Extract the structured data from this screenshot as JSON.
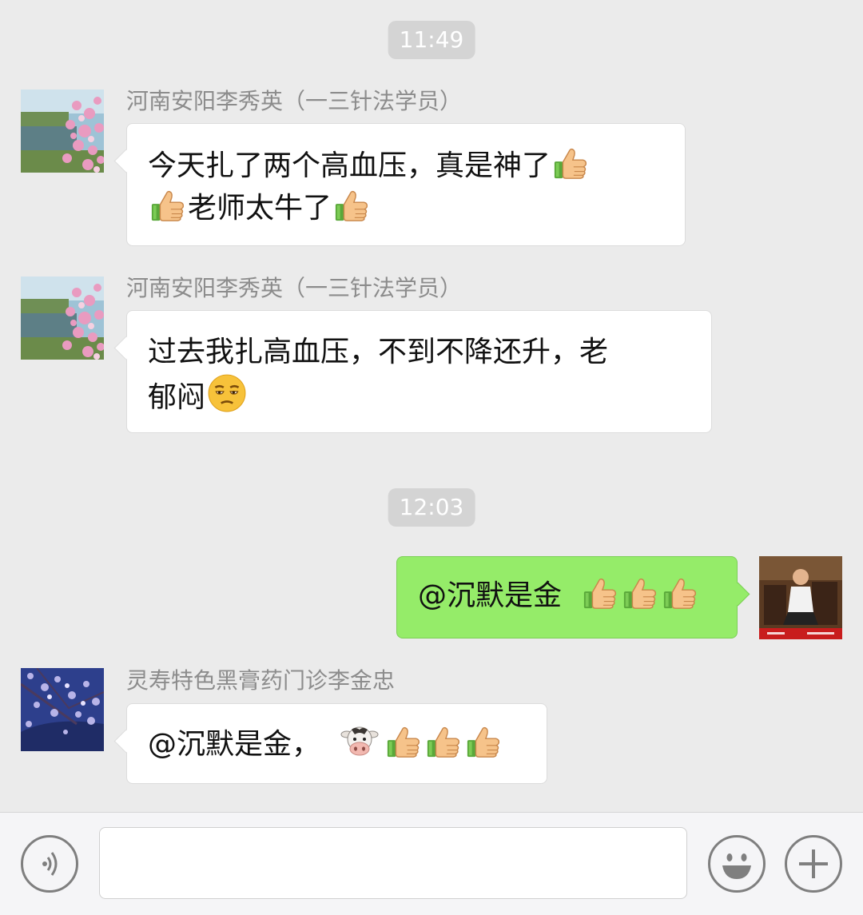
{
  "timestamps": [
    "11:49",
    "12:03"
  ],
  "messages": [
    {
      "sender": "河南安阳李秀英（一三针法学员）",
      "line1": "今天扎了两个高血压，真是神了",
      "line2": "老师太牛了"
    },
    {
      "sender": "河南安阳李秀英（一三针法学员）",
      "line1": "过去我扎高血压，不到不降还升，老",
      "line2": "郁闷"
    },
    {
      "text": "@沉默是金"
    },
    {
      "sender": "灵寿特色黑膏药门诊李金忠",
      "text": "@沉默是金，"
    }
  ],
  "icons": {
    "thumbs_up": "thumbs-up-icon",
    "unamused": "unamused-face-icon",
    "cow": "cow-face-icon",
    "voice": "voice-icon",
    "emoji": "emoji-icon",
    "plus": "plus-icon"
  },
  "colors": {
    "background": "#ebebeb",
    "my_bubble": "#95ec69",
    "other_bubble": "#ffffff",
    "timestamp_bg": "#d4d4d4"
  }
}
